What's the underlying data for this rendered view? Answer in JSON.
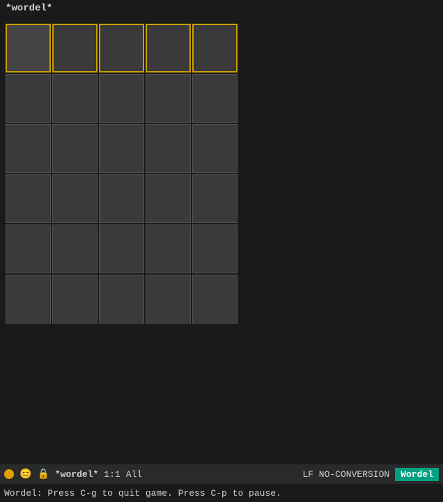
{
  "title": "*wordel*",
  "grid": {
    "rows": 6,
    "cols": 5,
    "active_row": 0,
    "cursor_col": 0
  },
  "status_bar": {
    "circle_color": "#e0a000",
    "emoji": "😊",
    "lock": "🔒",
    "filename": "*wordel*",
    "position": "1:1",
    "view": "All",
    "encoding": "LF NO-CONVERSION",
    "mode": "Wordel"
  },
  "message_bar": {
    "text": "Wordel: Press C-g to quit game. Press C-p to pause."
  }
}
